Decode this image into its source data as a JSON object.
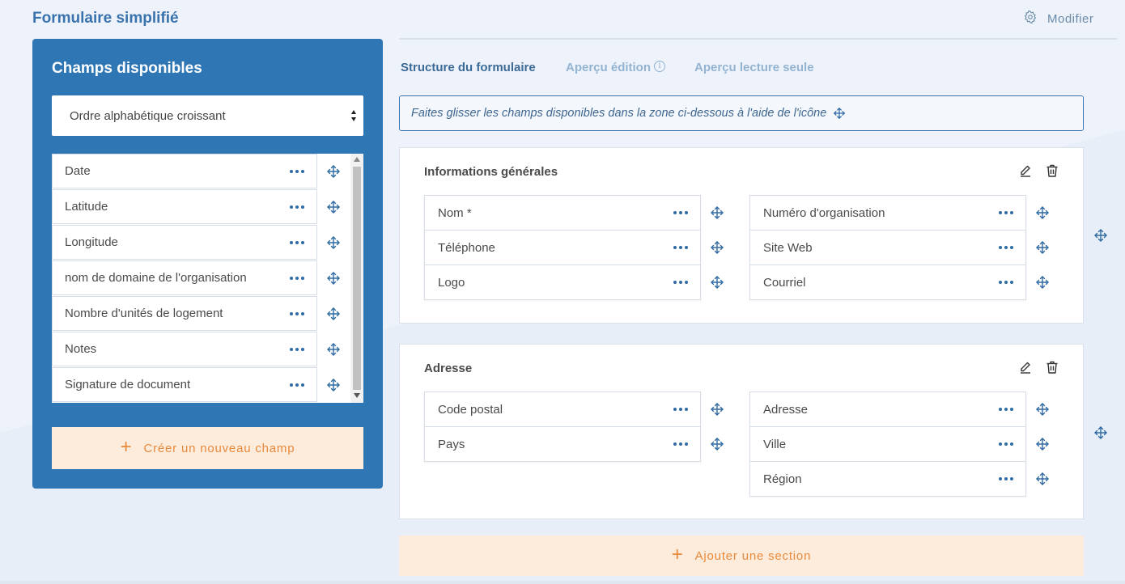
{
  "page_title": "Formulaire simplifié",
  "modify_label": "Modifier",
  "left_panel": {
    "title": "Champs disponibles",
    "sort_value": "Ordre alphabétique croissant",
    "fields": [
      "Date",
      "Latitude",
      "Longitude",
      "nom de domaine de l'organisation",
      "Nombre d'unités de logement",
      "Notes",
      "Signature de document"
    ],
    "create_label": "Créer un nouveau champ"
  },
  "tabs": [
    "Structure du formulaire",
    "Aperçu édition",
    "Aperçu lecture seule"
  ],
  "hint": "Faites glisser les champs disponibles dans la zone ci-dessous à l'aide de l'icône",
  "sections": [
    {
      "title": "Informations générales",
      "left_fields": [
        "Nom *",
        "Téléphone",
        "Logo"
      ],
      "right_fields": [
        "Numéro d'organisation",
        "Site Web",
        "Courriel"
      ]
    },
    {
      "title": "Adresse",
      "left_fields": [
        "Code postal",
        "Pays"
      ],
      "right_fields": [
        "Adresse",
        "Ville",
        "Région"
      ]
    }
  ],
  "add_section_label": "Ajouter une section",
  "colors": {
    "primary": "#2f76b5",
    "accent_orange": "#e88a3c",
    "accent_bg": "#fdebdc",
    "page_bg": "#eef3fb"
  },
  "icons": [
    "gear-icon",
    "move-icon",
    "dots-icon",
    "edit-icon",
    "trash-icon",
    "info-icon",
    "plus-icon",
    "sort-arrows-icon"
  ]
}
